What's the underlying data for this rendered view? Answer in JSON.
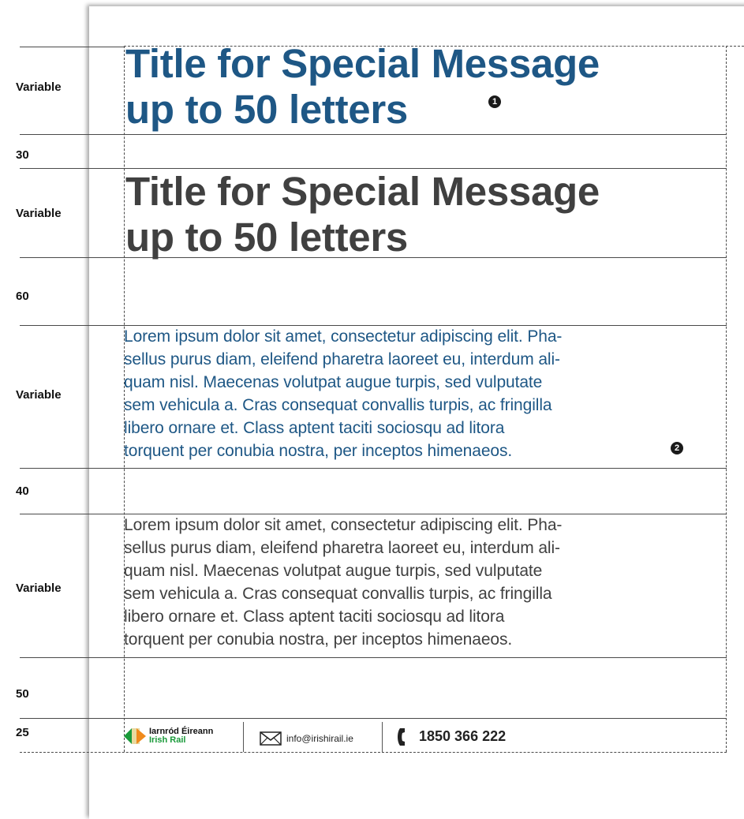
{
  "labels": {
    "row1": "Variable",
    "gap1": "30",
    "row2": "Variable",
    "gap2": "60",
    "row3": "Variable",
    "gap3": "40",
    "row4": "Variable",
    "gap4": "50",
    "row5": "25"
  },
  "title_blue": {
    "line1": "Title for Special Message",
    "line2": "up to 50 letters"
  },
  "title_grey": {
    "line1": "Title for Special Message",
    "line2": "up to 50 letters"
  },
  "callouts": {
    "one": "1",
    "two": "2"
  },
  "body_blue": {
    "line1": "Lorem ipsum dolor sit amet, consectetur adipiscing elit. Pha-",
    "line2": "sellus purus diam, eleifend pharetra laoreet eu, interdum ali-",
    "line3": "quam nisl. Maecenas volutpat augue turpis, sed vulputate",
    "line4": "sem vehicula a. Cras consequat convallis turpis, ac fringilla",
    "line5": "libero ornare et. Class aptent taciti sociosqu ad litora",
    "line6": "torquent per conubia nostra, per inceptos himenaeos."
  },
  "body_grey": {
    "line1": "Lorem ipsum dolor sit amet, consectetur adipiscing elit. Pha-",
    "line2": "sellus purus diam, eleifend pharetra laoreet eu, interdum ali-",
    "line3": "quam nisl. Maecenas volutpat augue turpis, sed vulputate",
    "line4": "sem vehicula a. Cras consequat convallis turpis, ac fringilla",
    "line5": "libero ornare et. Class aptent taciti sociosqu ad litora",
    "line6": "torquent per conubia nostra, per inceptos himenaeos."
  },
  "footer": {
    "logo_irish": "Iarnród Éireann",
    "logo_english": "Irish Rail",
    "email": "info@irishirail.ie",
    "phone": "1850 366 222",
    "icons": [
      "rail-logo-icon",
      "envelope-icon",
      "phone-icon"
    ]
  },
  "colors": {
    "brand_blue": "#1e5785",
    "text_grey": "#404040",
    "logo_green": "#1a9a3a",
    "logo_orange": "#f08a1c"
  }
}
